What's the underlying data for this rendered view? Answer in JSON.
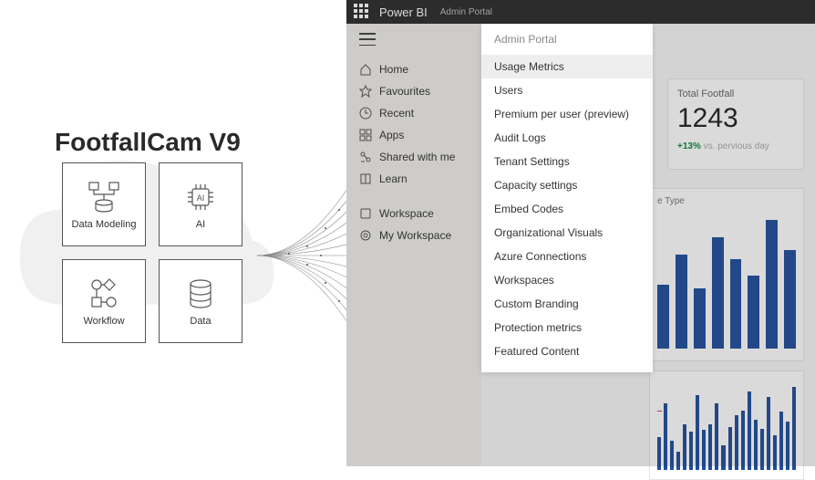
{
  "brand": {
    "title": "FootfallCam V9"
  },
  "tiles": [
    {
      "label": "Data Modeling"
    },
    {
      "label": "AI"
    },
    {
      "label": "Workflow"
    },
    {
      "label": "Data"
    }
  ],
  "pbi": {
    "app_title": "Power BI",
    "breadcrumb": "Admin Portal",
    "nav": {
      "group1": [
        {
          "icon": "home",
          "label": "Home"
        },
        {
          "icon": "star",
          "label": "Favourites"
        },
        {
          "icon": "clock",
          "label": "Recent"
        },
        {
          "icon": "grid",
          "label": "Apps"
        },
        {
          "icon": "share",
          "label": "Shared with me"
        },
        {
          "icon": "book",
          "label": "Learn"
        }
      ],
      "group2": [
        {
          "icon": "workspace",
          "label": "Workspace"
        },
        {
          "icon": "my-workspace",
          "label": "My Workspace"
        }
      ]
    },
    "admin_panel": {
      "title": "Admin Portal",
      "selected": "Usage Metrics",
      "items": [
        "Usage Metrics",
        "Users",
        "Premium per user (preview)",
        "Audit Logs",
        "Tenant Settings",
        "Capacity settings",
        "Embed Codes",
        "Organizational Visuals",
        "Azure Connections",
        "Workspaces",
        "Custom Branding",
        "Protection metrics",
        "Featured Content"
      ]
    },
    "dashboard": {
      "card": {
        "label": "Total Footfall",
        "value": "1243",
        "delta_pct": "+13%",
        "delta_suffix": "vs. pervious day"
      },
      "chart1_title": "e Type"
    }
  },
  "chart_data": [
    {
      "type": "bar",
      "title": "e Type",
      "values": [
        75,
        110,
        70,
        130,
        105,
        85,
        150,
        115
      ],
      "ylim": [
        0,
        160
      ]
    },
    {
      "type": "bar",
      "values": [
        40,
        80,
        35,
        22,
        55,
        46,
        90,
        48,
        55,
        80,
        30,
        52,
        66,
        72,
        95,
        60,
        50,
        88,
        42,
        70,
        58,
        100
      ],
      "threshold": 65,
      "ylim": [
        0,
        110
      ]
    }
  ]
}
